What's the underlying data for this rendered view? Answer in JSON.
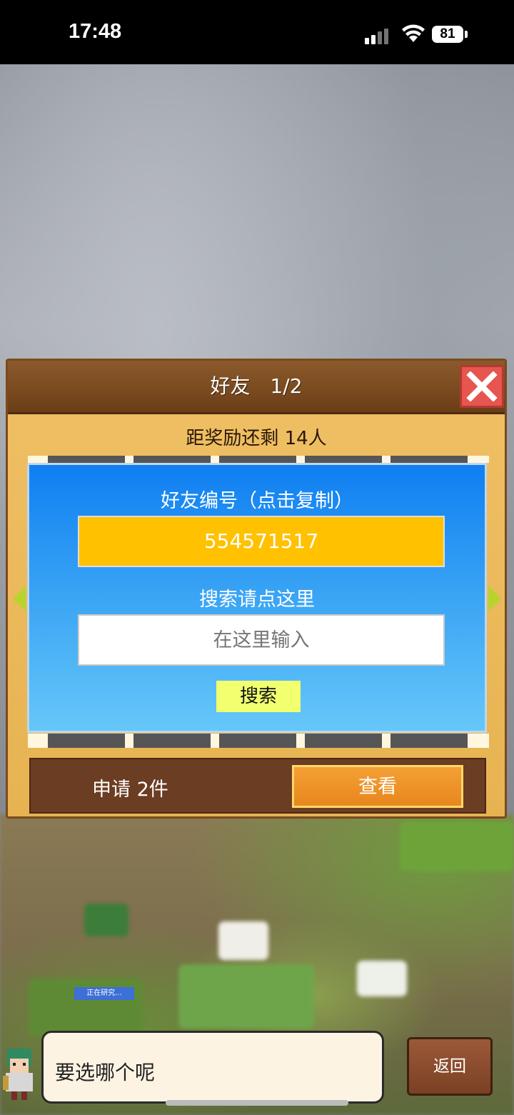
{
  "status_bar": {
    "time": "17:48",
    "battery": "81"
  },
  "dialog": {
    "title": "好友　1/2",
    "reward_remaining": "距奖励还剩 14人",
    "friend_id_label": "好友编号（点击复制）",
    "friend_id": "554571517",
    "search_label": "搜索请点这里",
    "search_placeholder": "在这里输入",
    "search_button": "搜索",
    "requests_text": "申请 2件",
    "view_button": "查看"
  },
  "scene": {
    "researching_tag": "正在研究..."
  },
  "message": {
    "text": "要选哪个呢",
    "back_button": "返回"
  },
  "colors": {
    "panel_blue": "#0f7ff2",
    "id_box_yellow": "#ffc100",
    "search_button": "#f2ff6e",
    "view_button": "#e7871d",
    "close_button": "#e6554e",
    "arrow_green": "#b8d42c"
  }
}
